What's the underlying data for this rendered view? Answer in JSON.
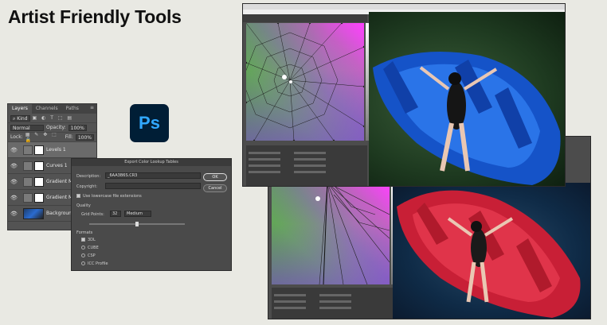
{
  "slide": {
    "title": "Artist Friendly Tools"
  },
  "layers_panel": {
    "tabs": [
      "Layers",
      "Channels",
      "Paths"
    ],
    "filter_label": "Kind",
    "blend_mode": "Normal",
    "opacity_label": "Opacity:",
    "opacity_value": "100%",
    "lock_label": "Lock:",
    "fill_label": "Fill:",
    "fill_value": "100%",
    "layers": [
      {
        "name": "Levels 1"
      },
      {
        "name": "Curves 1"
      },
      {
        "name": "Gradient Ma"
      },
      {
        "name": "Gradient Ma"
      },
      {
        "name": "Background"
      }
    ]
  },
  "ps_logo": {
    "text": "Ps"
  },
  "export_dialog": {
    "title": "Export Color Lookup Tables",
    "description_label": "Description:",
    "description_value": "_6AA3B6S.CR3",
    "copyright_label": "Copyright:",
    "lowercase_label": "Use lowercase file extensions",
    "quality_label": "Quality",
    "grid_points_label": "Grid Points:",
    "grid_points_value": "32",
    "grid_quality": "Medium",
    "formats_label": "Formats",
    "formats": [
      "3DL",
      "CUBE",
      "CSP",
      "ICC Profile"
    ],
    "ok_label": "OK",
    "cancel_label": "Cancel"
  },
  "colors": {
    "ps_bg": "#001e36",
    "ps_text": "#31a8ff",
    "boat_blue": "#1f5fd8",
    "boat_red": "#d8243a"
  }
}
